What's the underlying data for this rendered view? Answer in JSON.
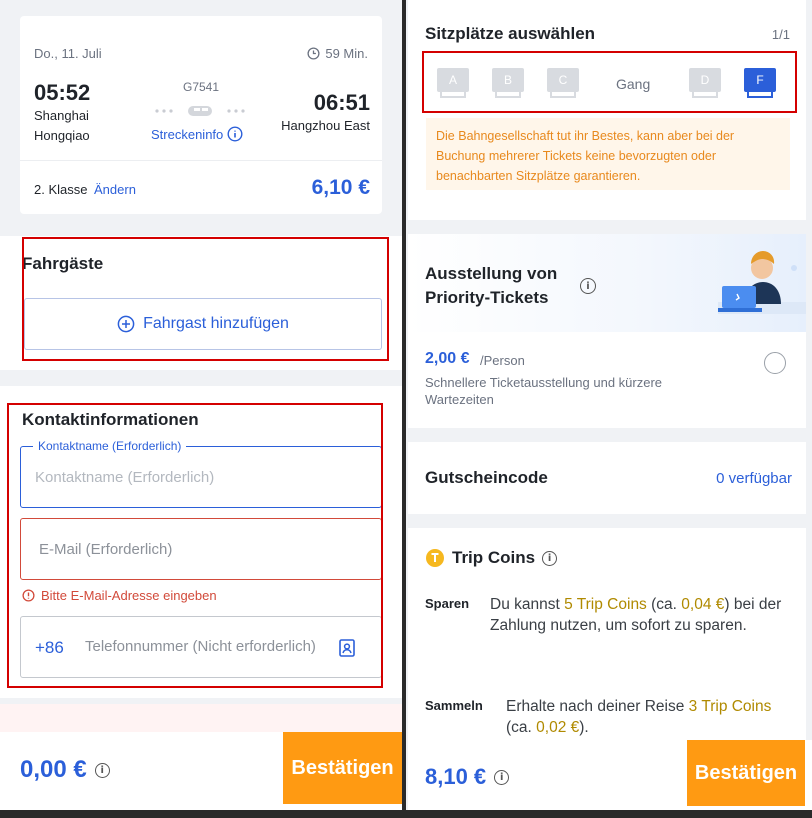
{
  "left": {
    "trip": {
      "date": "Do., 11. Juli",
      "duration": "59 Min.",
      "depart_time": "05:52",
      "depart_station_line1": "Shanghai",
      "depart_station_line2": "Hongqiao",
      "train_number": "G7541",
      "route_info": "Streckeninfo",
      "arrive_time": "06:51",
      "arrive_station": "Hangzhou East",
      "class_label": "2. Klasse",
      "change_label": "Ändern",
      "price": "6,10 €"
    },
    "passengers": {
      "title": "Fahrgäste",
      "add_label": "Fahrgast hinzufügen"
    },
    "contact": {
      "title": "Kontaktinformationen",
      "name_legend": "Kontaktname (Erforderlich)",
      "name_placeholder": "Kontaktname (Erforderlich)",
      "email_placeholder": "E-Mail (Erforderlich)",
      "email_error": "Bitte E-Mail-Adresse eingeben",
      "phone_prefix": "+86",
      "phone_placeholder": "Telefonnummer (Nicht erforderlich)"
    },
    "footer": {
      "total": "0,00 €",
      "confirm": "Bestätigen"
    }
  },
  "right": {
    "seats": {
      "title": "Sitzplätze auswählen",
      "counter": "1/1",
      "labels": [
        "A",
        "B",
        "C",
        "D",
        "F"
      ],
      "aisle": "Gang",
      "selected": "F",
      "notice": "Die Bahngesellschaft tut ihr Bestes, kann aber bei der Buchung mehrerer Tickets keine bevorzugten oder benachbarten Sitzplätze garantieren."
    },
    "priority": {
      "title_line1": "Ausstellung von",
      "title_line2": "Priority-Tickets",
      "price": "2,00 €",
      "per": "/Person",
      "desc": "Schnellere Ticketausstellung und kürzere Wartezeiten"
    },
    "voucher": {
      "title": "Gutscheincode",
      "available": "0 verfügbar"
    },
    "trip_coins": {
      "title": "Trip Coins",
      "save_label": "Sparen",
      "save_text_1": "Du kannst ",
      "save_coins": "5 Trip Coins",
      "save_text_2": " (ca. ",
      "save_value": "0,04 €",
      "save_text_3": ") bei der Zahlung nutzen, um sofort zu sparen.",
      "earn_label": "Sammeln",
      "earn_text_1": "Erhalte nach deiner Reise ",
      "earn_coins": "3 Trip Coins",
      "earn_text_2": " (ca. ",
      "earn_value": "0,02 €",
      "earn_text_3": ")."
    },
    "footer": {
      "total": "8,10 €",
      "confirm": "Bestätigen"
    }
  },
  "colors": {
    "accent_blue": "#2b5fd9",
    "confirm_orange": "#ff9a12",
    "error_red": "#d40000",
    "notice_orange": "#e8891d",
    "coin_gold": "#b08a00"
  },
  "icons": [
    "clock-icon",
    "train-icon",
    "info-icon",
    "plus-circle-icon",
    "alert-icon",
    "contact-book-icon",
    "trip-coin-icon",
    "radio-icon",
    "agent-illustration"
  ]
}
